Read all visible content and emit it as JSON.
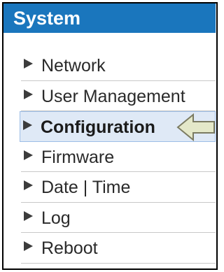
{
  "header": {
    "title": "System"
  },
  "menu": {
    "items": [
      {
        "label": "Network"
      },
      {
        "label": "User Management"
      },
      {
        "label": "Configuration"
      },
      {
        "label": "Firmware"
      },
      {
        "label": "Date | Time"
      },
      {
        "label": "Log"
      },
      {
        "label": "Reboot"
      }
    ],
    "active_item": "Configuration"
  },
  "colors": {
    "header_bg": "#1a76bd",
    "active_bg": "#dfe9f6",
    "arrow_fill": "#e4e8c9"
  },
  "icons": {
    "item_marker": "triangle-right-icon",
    "pointer": "arrow-left-icon"
  }
}
